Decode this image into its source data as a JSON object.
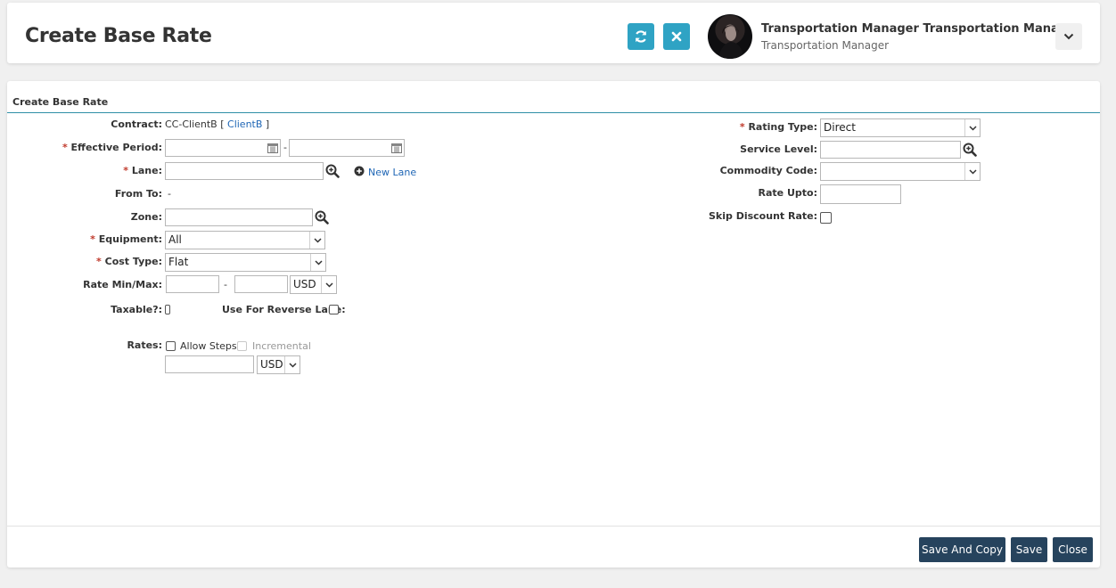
{
  "header": {
    "title": "Create Base Rate",
    "user_name": "Transportation Manager Transportation Mana...",
    "user_role": "Transportation Manager"
  },
  "panel": {
    "title": "Create Base Rate"
  },
  "form": {
    "contract_label": "Contract:",
    "contract_value": "CC-ClientB [",
    "contract_link": "ClientB",
    "contract_close": "]",
    "effective_label": "Effective Period:",
    "effective_sep": "-",
    "lane_label": "Lane:",
    "new_lane": "New Lane",
    "fromto_label": "From To:",
    "fromto_value": "-",
    "zone_label": "Zone:",
    "equipment_label": "Equipment:",
    "equipment_value": "All",
    "costtype_label": "Cost Type:",
    "costtype_value": "Flat",
    "rate_minmax_label": "Rate Min/Max:",
    "rate_minmax_sep": "-",
    "rate_currency": "USD",
    "taxable_label": "Taxable?:",
    "reverse_label": "Use For Reverse Lane:",
    "rates_label": "Rates:",
    "allow_steps": "Allow Steps",
    "incremental": "Incremental",
    "rates_currency": "USD",
    "rating_type_label": "Rating Type:",
    "rating_type_value": "Direct",
    "service_level_label": "Service Level:",
    "commodity_label": "Commodity Code:",
    "rate_upto_label": "Rate Upto:",
    "skip_discount_label": "Skip Discount Rate:",
    "required_mark": "*"
  },
  "buttons": {
    "save_and_copy": "Save And Copy",
    "save": "Save",
    "close": "Close"
  },
  "colors": {
    "accent": "#2fa3c4",
    "button": "#26435d",
    "required": "#c0392b",
    "link": "#1f66b5"
  }
}
